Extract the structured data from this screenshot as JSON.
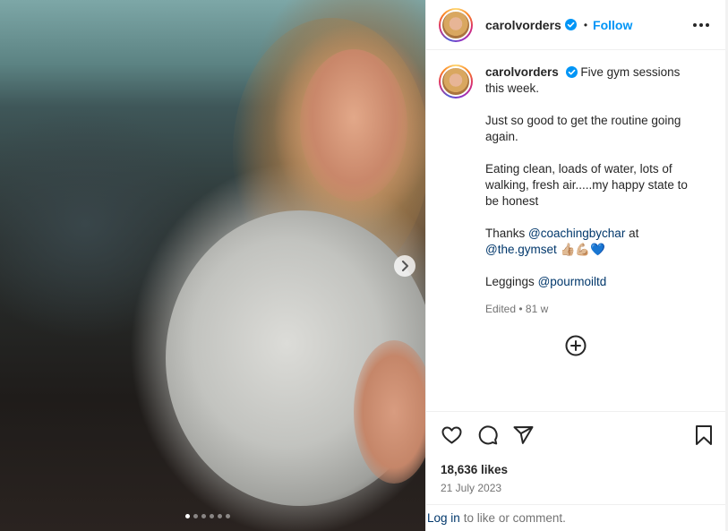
{
  "post": {
    "image_alt": "Woman with wavy blonde hair in a grey crop top",
    "carousel_count": 6,
    "carousel_active": 1
  },
  "header": {
    "username": "carolvorders",
    "separator": "•",
    "follow_label": "Follow"
  },
  "caption": {
    "username": "carolvorders",
    "line1": "Five gym sessions this week.",
    "para2": "Just so good to get the routine going again.",
    "para3": "Eating clean, loads of water, lots of walking, fresh air.....my happy state to be honest",
    "thanks_prefix": "Thanks",
    "mention1": "@coachingbychar",
    "at_word": "at",
    "mention2": "@the.gymset",
    "emojis": "👍🏼💪🏼💙",
    "leggings_prefix": "Leggings",
    "mention3": "@pourmoiltd",
    "edited": "Edited",
    "dot": "•",
    "age": "81 w"
  },
  "stats": {
    "likes": "18,636 likes",
    "date": "21 July 2023"
  },
  "footer": {
    "login_label": "Log in",
    "rest": "to like or comment."
  },
  "colors": {
    "link_blue": "#0095f6",
    "mention_blue": "#00376b",
    "muted": "#737373",
    "text": "#262626"
  },
  "icons": [
    "chevron-right-icon",
    "verified-badge-icon",
    "more-icon",
    "add-comment-icon",
    "heart-icon",
    "comment-icon",
    "share-icon",
    "bookmark-icon"
  ]
}
